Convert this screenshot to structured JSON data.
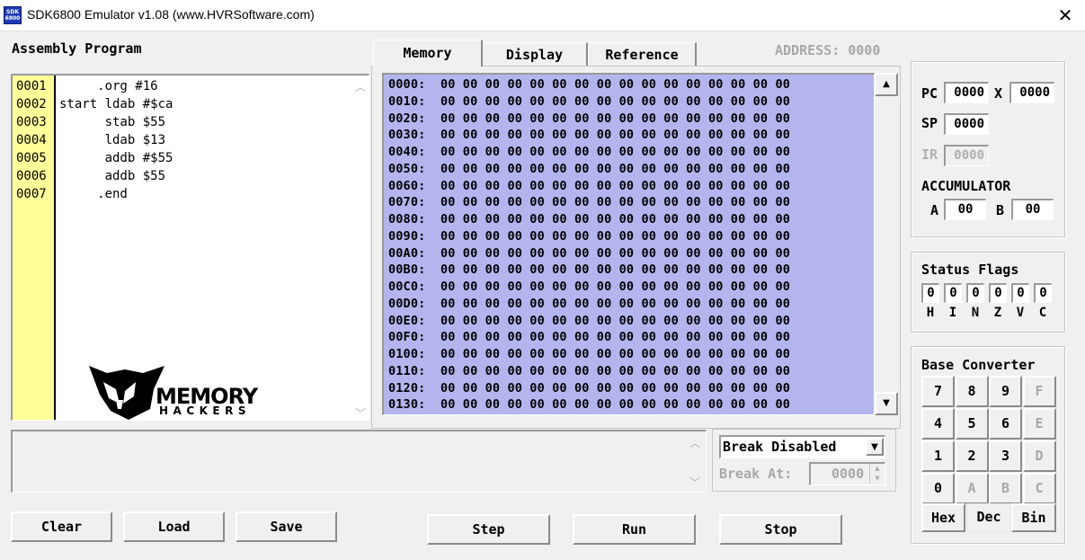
{
  "window": {
    "icon_text": "SDK\n6800",
    "title": "SDK6800 Emulator v1.08 (www.HVRSoftware.com)",
    "close_glyph": "✕"
  },
  "assembly": {
    "title": "Assembly Program",
    "line_numbers": [
      "0001",
      "0002",
      "0003",
      "0004",
      "0005",
      "0006",
      "0007"
    ],
    "lines": [
      "     .org #16",
      "start ldab #$ca",
      "      stab $55",
      "      ldab $13",
      "      addb #$55",
      "      addb $55",
      "     .end"
    ],
    "logo_text_top": "MEMORY",
    "logo_text_bottom": "HACKERS"
  },
  "tabs": [
    {
      "label": "Memory",
      "active": true
    },
    {
      "label": "Display",
      "active": false
    },
    {
      "label": "Reference",
      "active": false
    }
  ],
  "address_label": "ADDRESS: 0000",
  "memory": {
    "addresses": [
      "0000",
      "0010",
      "0020",
      "0030",
      "0040",
      "0050",
      "0060",
      "0070",
      "0080",
      "0090",
      "00A0",
      "00B0",
      "00C0",
      "00D0",
      "00E0",
      "00F0",
      "0100",
      "0110",
      "0120",
      "0130"
    ],
    "bytes": "00 00 00 00 00 00 00 00 00 00 00 00 00 00 00 00"
  },
  "break": {
    "mode": "Break Disabled",
    "at_label": "Break At:",
    "at_value": "0000"
  },
  "registers": {
    "pc_label": "PC",
    "pc": "0000",
    "x_label": "X",
    "x": "0000",
    "sp_label": "SP",
    "sp": "0000",
    "ir_label": "IR",
    "ir": "0000",
    "accumulator_label": "ACCUMULATOR",
    "a_label": "A",
    "a": "00",
    "b_label": "B",
    "b": "00"
  },
  "flags": {
    "title": "Status Flags",
    "names": [
      "H",
      "I",
      "N",
      "Z",
      "V",
      "C"
    ],
    "values": [
      "0",
      "0",
      "0",
      "0",
      "0",
      "0"
    ]
  },
  "base_converter": {
    "title": "Base Converter",
    "keys": [
      {
        "label": "7",
        "enabled": true
      },
      {
        "label": "8",
        "enabled": true
      },
      {
        "label": "9",
        "enabled": true
      },
      {
        "label": "F",
        "enabled": false
      },
      {
        "label": "4",
        "enabled": true
      },
      {
        "label": "5",
        "enabled": true
      },
      {
        "label": "6",
        "enabled": true
      },
      {
        "label": "E",
        "enabled": false
      },
      {
        "label": "1",
        "enabled": true
      },
      {
        "label": "2",
        "enabled": true
      },
      {
        "label": "3",
        "enabled": true
      },
      {
        "label": "D",
        "enabled": false
      },
      {
        "label": "0",
        "enabled": true
      },
      {
        "label": "A",
        "enabled": false
      },
      {
        "label": "B",
        "enabled": false
      },
      {
        "label": "C",
        "enabled": false
      }
    ],
    "modes": [
      "Hex",
      "Dec",
      "Bin"
    ],
    "selected_mode": "Dec"
  },
  "buttons": {
    "clear": "Clear",
    "load": "Load",
    "save": "Save",
    "step": "Step",
    "run": "Run",
    "stop": "Stop"
  }
}
